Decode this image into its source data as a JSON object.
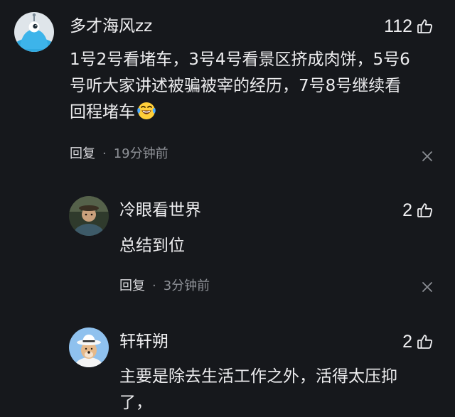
{
  "comments": [
    {
      "username": "多才海风zz",
      "likes": "112",
      "text_lines": [
        "1号2号看堵车，3号4号看景区挤成肉饼，5号6",
        "号听大家讲述被骗被宰的经历，7号8号继续看",
        "回程堵车"
      ],
      "emoji": "laughing-crying-emoji",
      "reply_label": "回复",
      "separator": "·",
      "time": "19分钟前"
    },
    {
      "username": "冷眼看世界",
      "likes": "2",
      "text": "总结到位",
      "reply_label": "回复",
      "separator": "·",
      "time": "3分钟前"
    },
    {
      "username": "轩轩朔",
      "likes": "2",
      "text_lines": [
        "主要是除去生活工作之外，活得太压抑",
        "了，"
      ]
    }
  ],
  "colors": {
    "background": "#16181c",
    "text": "#ececee",
    "muted": "#8f9298"
  },
  "icons": {
    "like": "thumbs-up-icon",
    "close": "close-icon"
  }
}
